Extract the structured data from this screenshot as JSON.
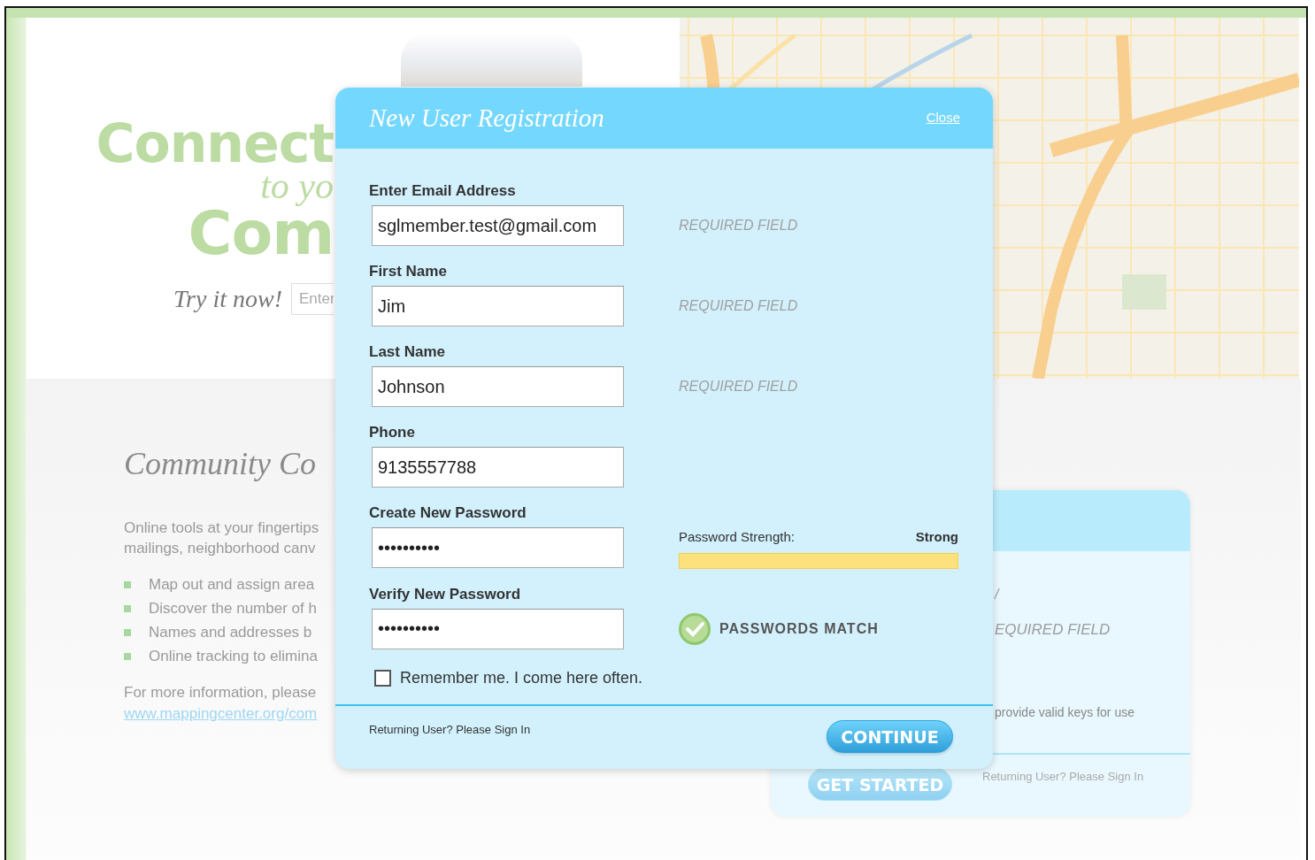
{
  "hero": {
    "headline_lines": [
      {
        "kind": "sans",
        "text": "Connect"
      },
      {
        "kind": "script",
        "text": "to yo"
      },
      {
        "kind": "big",
        "text": "Com"
      }
    ],
    "try_label": "Try it now!",
    "try_placeholder": "Enter"
  },
  "intro": {
    "title": "Community Co",
    "paragraph_lines": [
      "Online tools at your fingertips",
      "mailings, neighborhood canv"
    ],
    "bullets": [
      "Map out and assign area",
      "Discover the number of h",
      "Names and addresses b",
      "Online tracking to elimina"
    ],
    "more_info": "For more information, please",
    "link": "www.mappingcenter.org/com"
  },
  "background_card": {
    "fragment": "/",
    "required_note": "EQUIRED FIELD",
    "note": "provide valid keys for use",
    "button": "GET STARTED",
    "returning_label": "Returning User?",
    "sign_in_link": "Please Sign In"
  },
  "modal": {
    "title": "New User Registration",
    "close": "Close",
    "fields": [
      {
        "label": "Enter Email Address",
        "value": "sglmember.test@gmail.com",
        "note": "REQUIRED FIELD"
      },
      {
        "label": "First Name",
        "value": "Jim",
        "note": "REQUIRED FIELD"
      },
      {
        "label": "Last Name",
        "value": "Johnson",
        "note": "REQUIRED FIELD"
      },
      {
        "label": "Phone",
        "value": "9135557788"
      },
      {
        "label": "Create New Password",
        "value": "••••••••••",
        "strength": {
          "label": "Password Strength:",
          "value": "Strong",
          "level": 1
        }
      },
      {
        "label": "Verify New Password",
        "value": "••••••••••",
        "match": {
          "text": "PASSWORDS MATCH",
          "ok": true
        }
      }
    ],
    "remember": {
      "label": "Remember me. I come here often.",
      "checked": false
    },
    "returning_label": "Returning User?",
    "sign_in_link": "Please Sign In",
    "continue": "CONTINUE"
  }
}
